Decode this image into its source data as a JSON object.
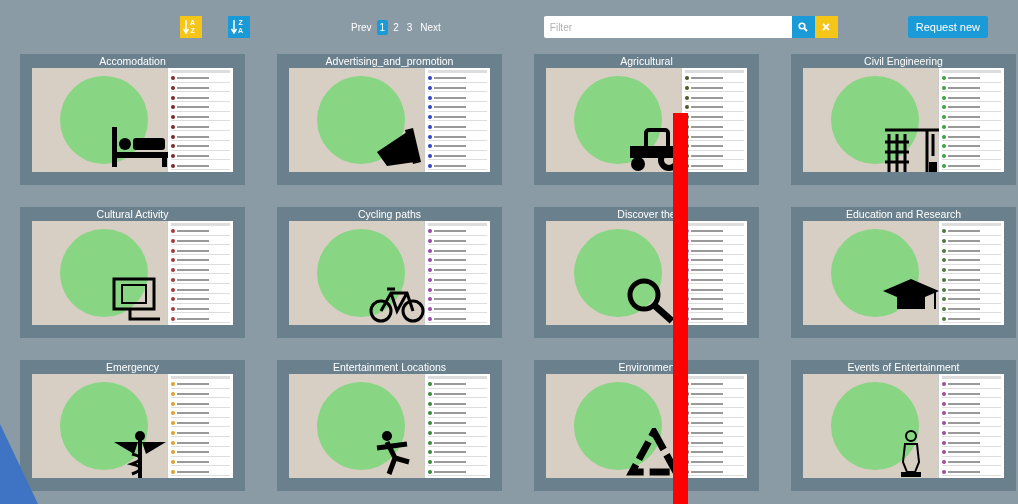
{
  "toolbar": {
    "sort_buttons": [
      {
        "kind": "az",
        "label_top": "A",
        "label_bottom": "Z"
      },
      {
        "kind": "za",
        "label_top": "Z",
        "label_bottom": "A"
      }
    ],
    "pagination": {
      "prev": "Prev",
      "pages": [
        {
          "label": "1",
          "selected": true
        },
        {
          "label": "2",
          "selected": false
        },
        {
          "label": "3",
          "selected": false
        }
      ],
      "next": "Next"
    },
    "filter": {
      "placeholder": "Filter"
    },
    "request_button": "Request new"
  },
  "cards": [
    {
      "title": "Accomodation"
    },
    {
      "title": "Advertising_and_promotion"
    },
    {
      "title": "Agricultural"
    },
    {
      "title": "Civil Engineering"
    },
    {
      "title": "Cultural Activity"
    },
    {
      "title": "Cycling paths"
    },
    {
      "title": "Discover the"
    },
    {
      "title": "Education and Research"
    },
    {
      "title": "Emergency"
    },
    {
      "title": "Entertainment Locations"
    },
    {
      "title": "Environmen"
    },
    {
      "title": "Events of Entertainment"
    }
  ]
}
